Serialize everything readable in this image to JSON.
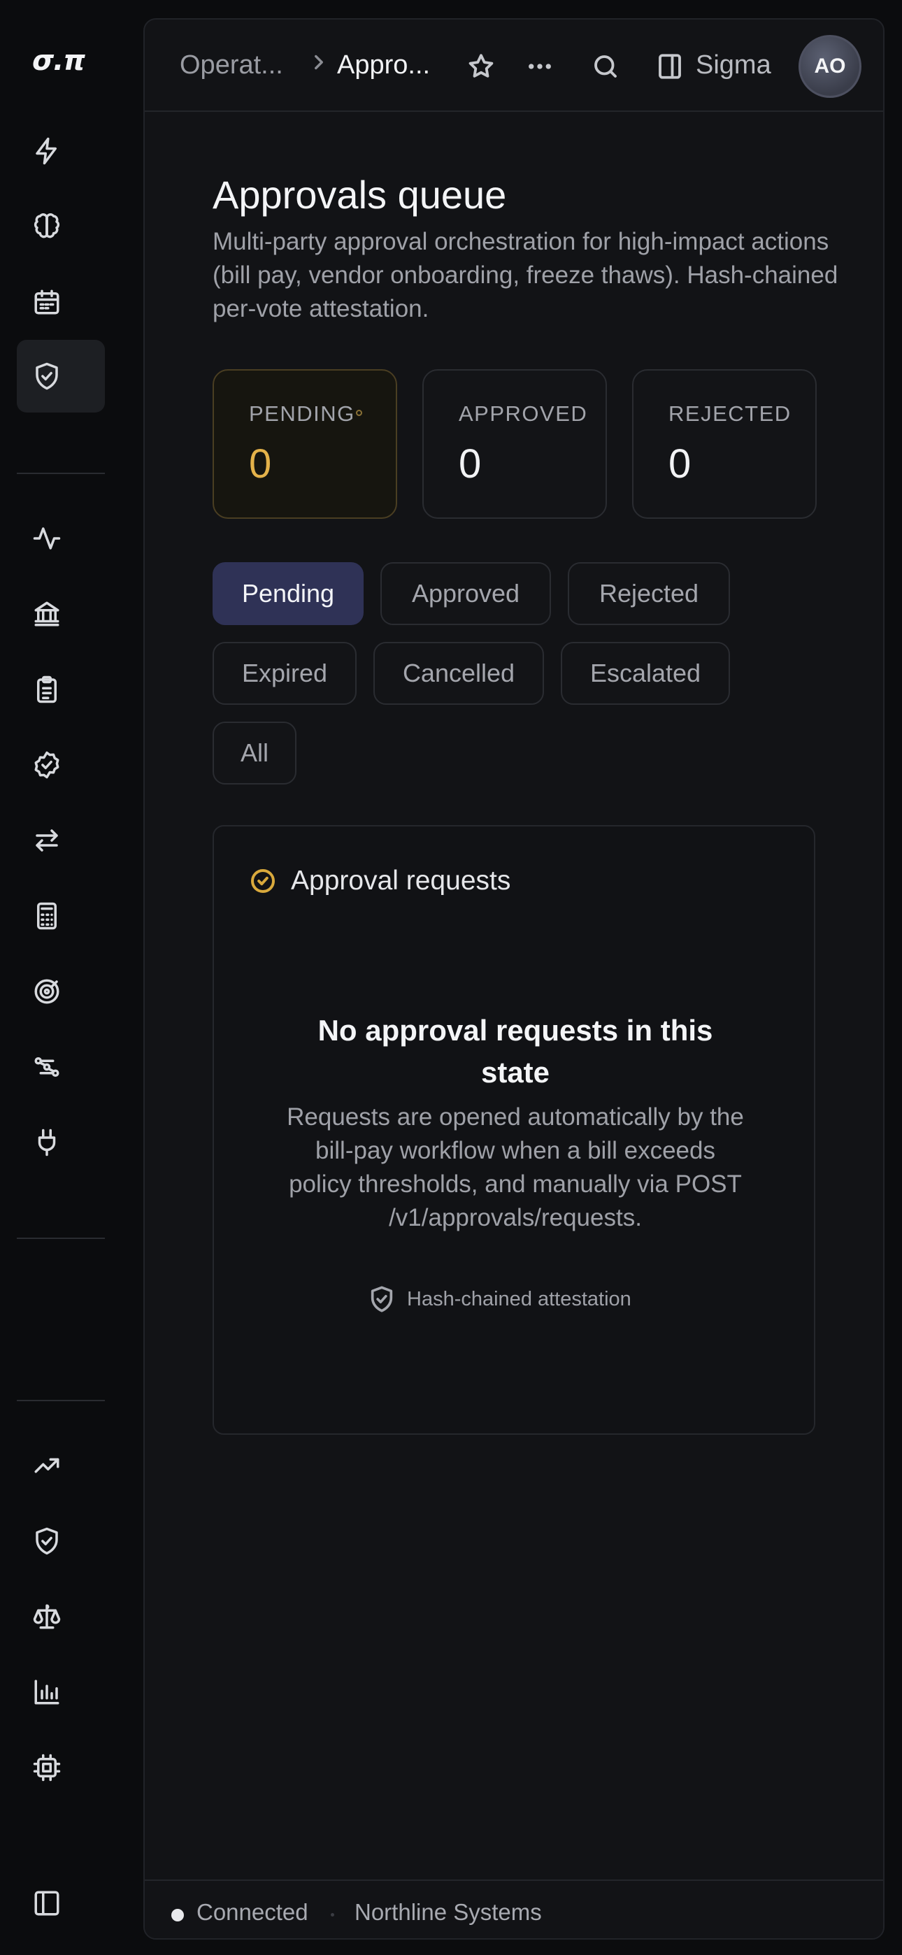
{
  "logo": "σ.π",
  "sidebar": {
    "items": [
      {
        "icon": "lightning-icon"
      },
      {
        "icon": "brain-icon"
      },
      {
        "icon": "calendar-icon"
      },
      {
        "icon": "shield-check-icon",
        "active": true
      },
      {
        "icon": "activity-icon"
      },
      {
        "icon": "bank-icon"
      },
      {
        "icon": "clipboard-icon"
      },
      {
        "icon": "badge-check-icon"
      },
      {
        "icon": "transfer-icon"
      },
      {
        "icon": "calculator-icon"
      },
      {
        "icon": "target-icon"
      },
      {
        "icon": "workflow-icon"
      },
      {
        "icon": "plug-icon"
      },
      {
        "icon": "trending-up-icon"
      },
      {
        "icon": "shield-check-icon"
      },
      {
        "icon": "scale-icon"
      },
      {
        "icon": "bar-chart-icon"
      },
      {
        "icon": "cpu-icon"
      },
      {
        "icon": "panel-toggle-icon"
      }
    ]
  },
  "header": {
    "breadcrumb_parent": "Operat...",
    "breadcrumb_current": "Appro...",
    "workspace": "Sigma",
    "avatar_initials": "AO"
  },
  "page": {
    "title": "Approvals queue",
    "description": "Multi-party approval orchestration for high-impact actions (bill pay, vendor onboarding, freeze thaws). Hash-chained per-vote attestation."
  },
  "stats": [
    {
      "label": "PENDING",
      "value": "0",
      "color": "#e4b24a"
    },
    {
      "label": "APPROVED",
      "value": "0"
    },
    {
      "label": "REJECTED",
      "value": "0"
    }
  ],
  "filters": [
    "Pending",
    "Approved",
    "Rejected",
    "Expired",
    "Cancelled",
    "Escalated",
    "All"
  ],
  "active_filter": "Pending",
  "card": {
    "title": "Approval requests",
    "empty_title": "No approval requests in this state",
    "empty_description": "Requests are opened automatically by the bill-pay workflow when a bill exceeds policy thresholds, and manually via POST /v1/approvals/requests.",
    "attestation": "Hash-chained attestation"
  },
  "status": {
    "connection": "Connected",
    "organization": "Northline Systems"
  },
  "colors": {
    "accent": "#2f3256",
    "pending": "#e4b24a"
  }
}
